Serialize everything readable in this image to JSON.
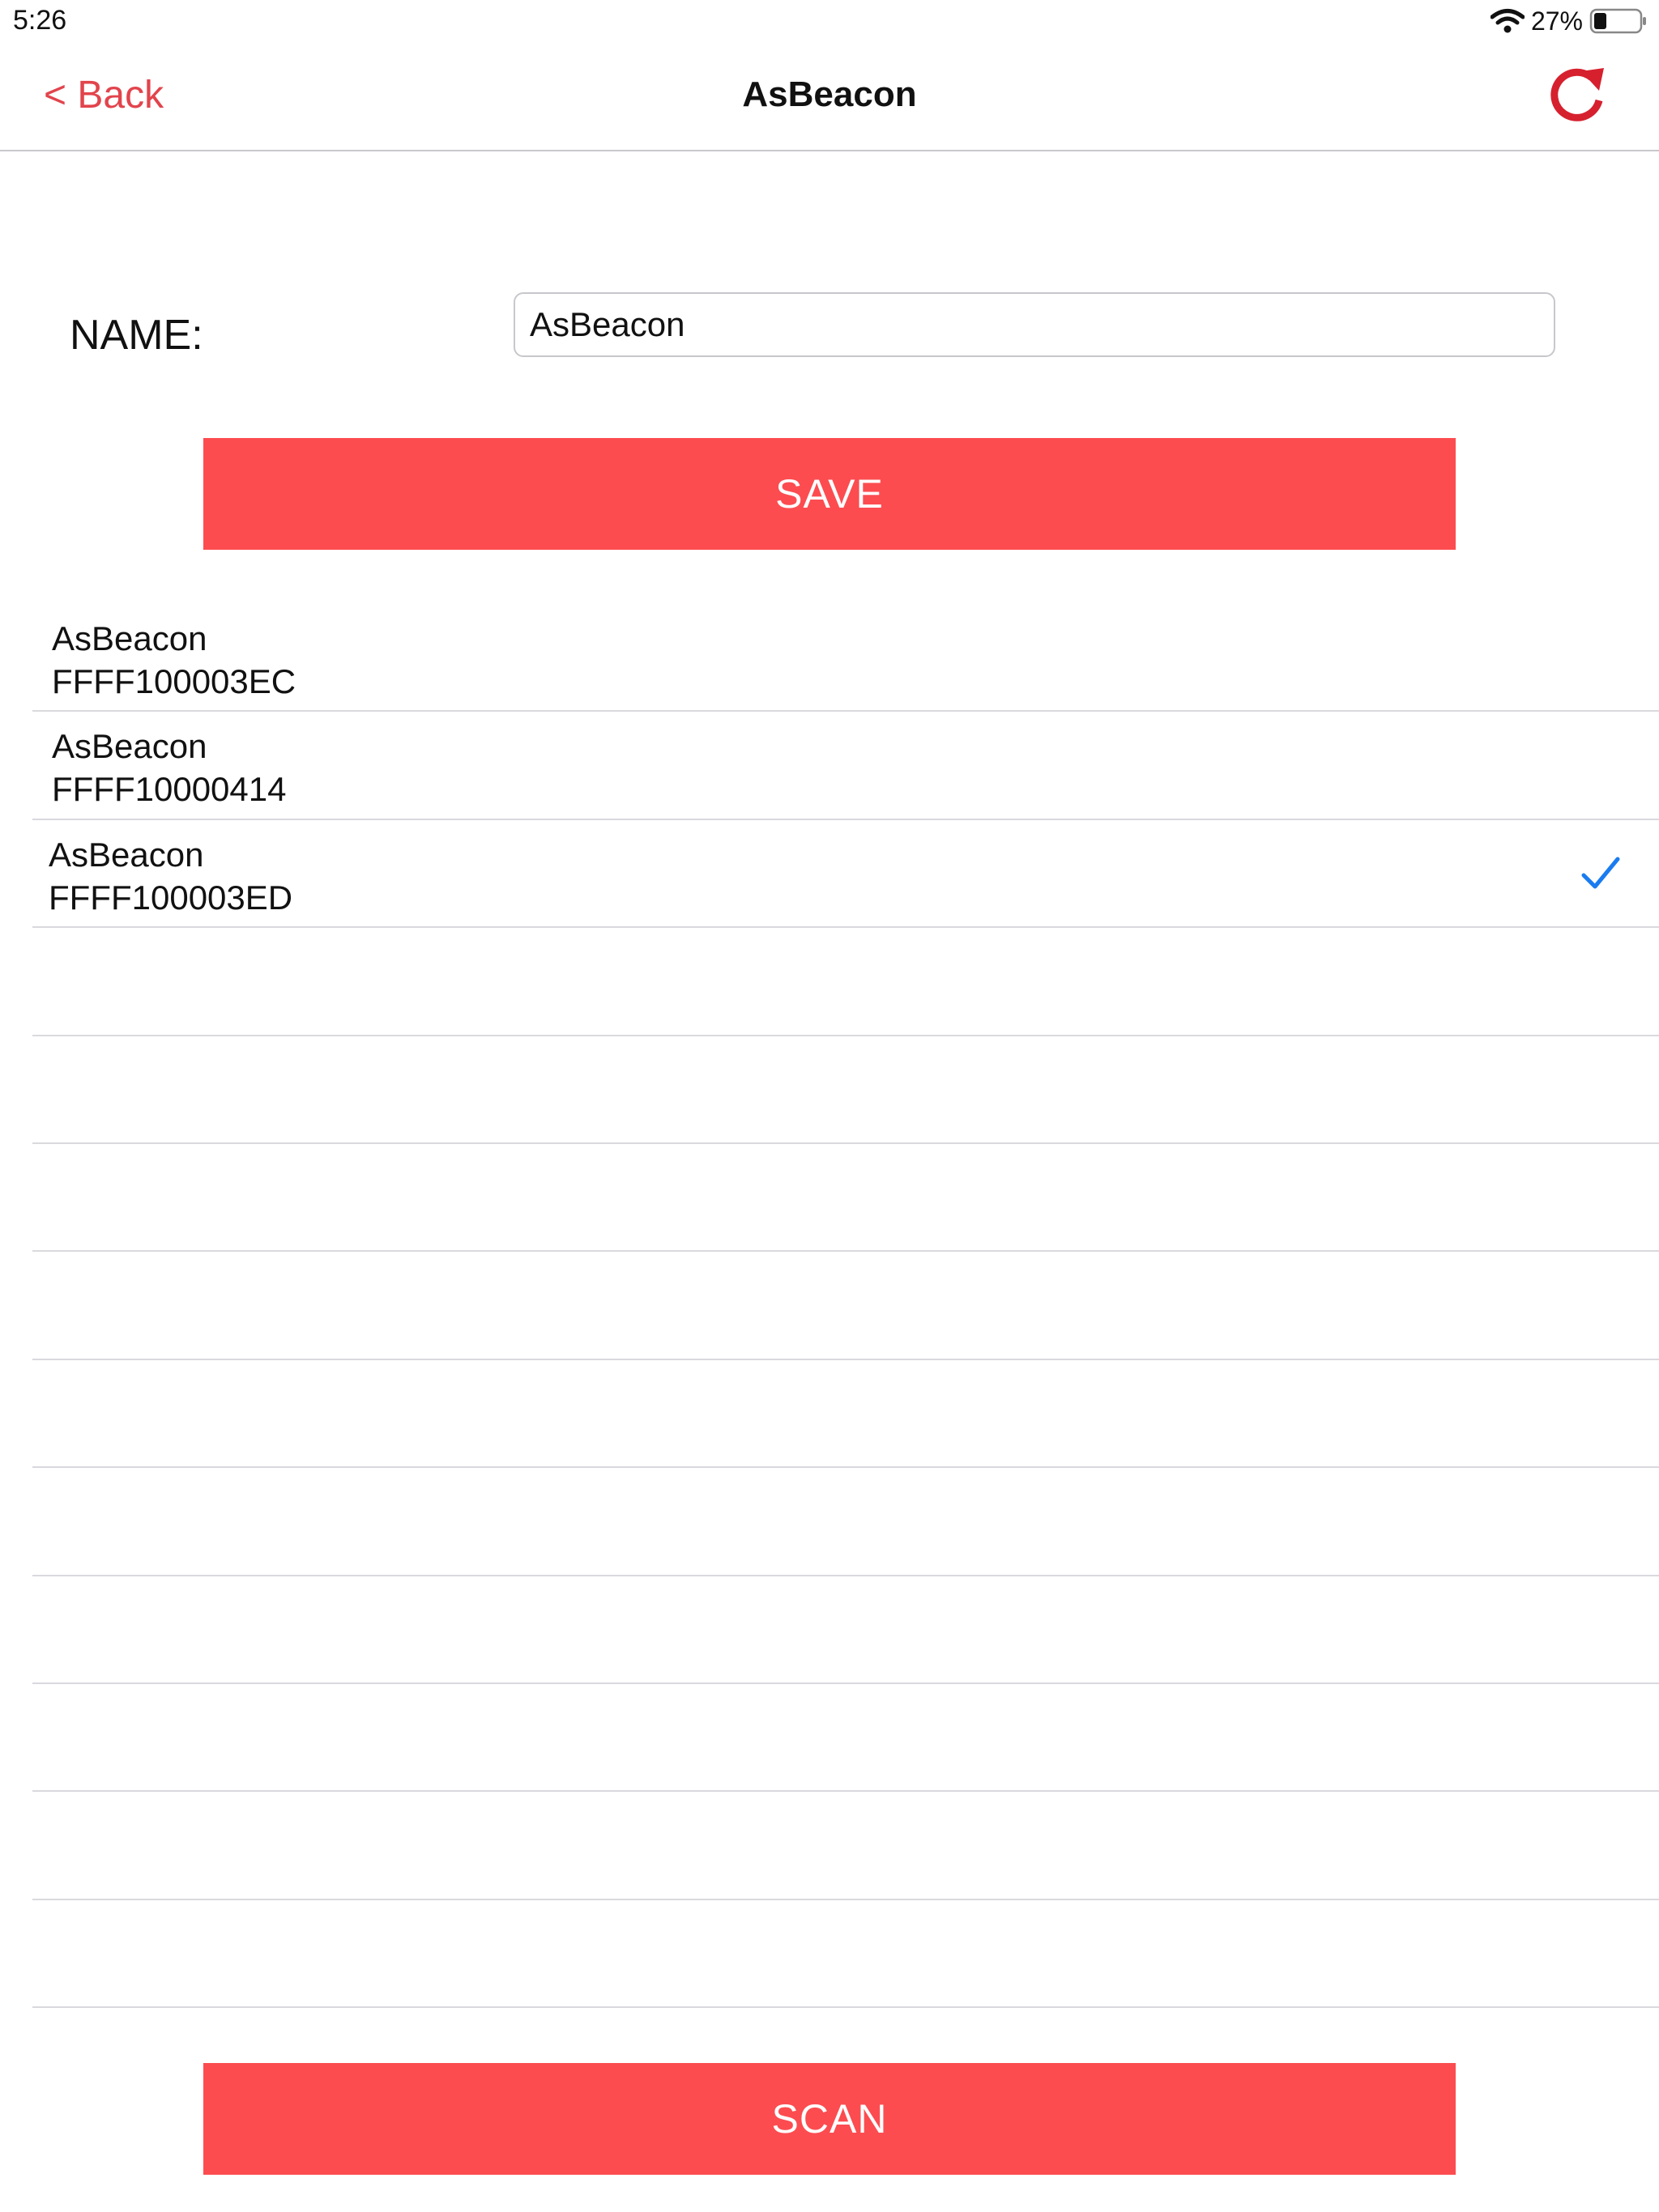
{
  "status_bar": {
    "time": "5:26",
    "battery_percent": "27%",
    "icons": [
      "wifi-icon",
      "battery-icon"
    ]
  },
  "nav": {
    "back_label": "< Back",
    "title": "AsBeacon",
    "refresh_icon": "refresh-icon"
  },
  "form": {
    "name_label": "NAME:",
    "name_value": "AsBeacon",
    "save_label": "SAVE"
  },
  "devices": [
    {
      "name": "AsBeacon",
      "id": "FFFF100003EC",
      "selected": false
    },
    {
      "name": "AsBeacon",
      "id": "FFFF10000414",
      "selected": false
    },
    {
      "name": "AsBeacon",
      "id": "FFFF100003ED",
      "selected": true
    }
  ],
  "scan_label": "SCAN",
  "colors": {
    "accent": "#fc4c50",
    "back_text": "#e2444c",
    "refresh_icon": "#d6202e",
    "checkmark": "#1a7cf0",
    "separator": "#d9d9de"
  }
}
